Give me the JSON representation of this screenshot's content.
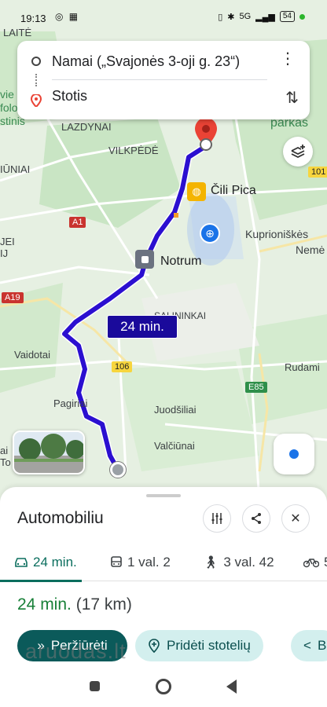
{
  "status_bar": {
    "time": "19:13",
    "left_icons": "◎ ▦",
    "battery": "54",
    "signal": "5G"
  },
  "route": {
    "origin": "Namai („Svajonės 3-oji g. 23“)",
    "destination": "Stotis"
  },
  "map": {
    "labels": {
      "laite": "LAITĖ",
      "vilkpede": "VILKPĖDĖ",
      "lazdynai": "LAZDYNAI",
      "cili_pica": "Čili Pica",
      "kuprioniskes": "Kuprioniškės",
      "neme": "Nemė",
      "notrum": "Notrum",
      "salininkai": "SALININKAI",
      "vaidotai": "Vaidotai",
      "rudami": "Rudami",
      "pagiriai": "Pagiriai",
      "juodsiliai": "Juodšiliai",
      "valciunai": "Valčiūnai",
      "parkas": "parkas",
      "iuniai": "IŪNIAI",
      "ai_to": "ai\nTo",
      "vie": "vie\nfolo\nstinis",
      "jei": "JEI\nIJ"
    },
    "road_badges": {
      "a1": "A1",
      "a19": "A19",
      "r106": "106",
      "r101": "101",
      "e85": "E85"
    },
    "eta_badge": "24 min."
  },
  "sheet": {
    "mode_title": "Automobiliu",
    "tabs": [
      {
        "icon": "car-icon",
        "label": "24 min."
      },
      {
        "icon": "transit-icon",
        "label": "1 val. 2"
      },
      {
        "icon": "walk-icon",
        "label": "3 val. 42"
      },
      {
        "icon": "bike-icon",
        "label": "5"
      }
    ],
    "summary_duration": "24 min.",
    "summary_distance": "(17 km)",
    "primary_button": "Peržiūrėti",
    "secondary_button": "Pridėti stotelių",
    "share_button": "B"
  },
  "watermark": "aruodas.lt",
  "colors": {
    "route": "#2b0fd0",
    "accent": "#0b5a5a",
    "active_tab": "#0b6e5e",
    "eta_badge": "#1a0a9b",
    "destination_pin": "#ea4335"
  }
}
